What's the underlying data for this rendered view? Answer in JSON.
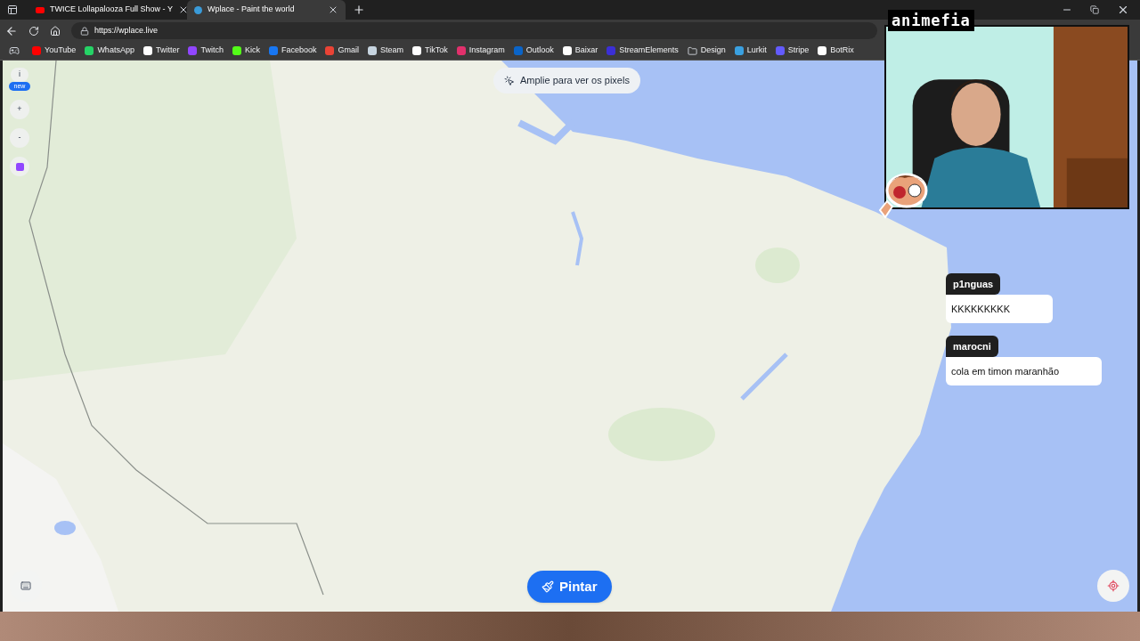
{
  "browser": {
    "tabs": [
      {
        "title": "TWICE Lollapalooza Full Show - Y",
        "selected": false
      },
      {
        "title": "Wplace - Paint the world",
        "selected": true
      }
    ],
    "url": "https://wplace.live",
    "bookmarks": [
      "YouTube",
      "WhatsApp",
      "Twitter",
      "Twitch",
      "Kick",
      "Facebook",
      "Gmail",
      "Steam",
      "TikTok",
      "Instagram",
      "Outlook",
      "Baixar",
      "StreamElements",
      "Design",
      "Lurkit",
      "Stripe",
      "BotRix"
    ]
  },
  "map": {
    "hint": "Amplie para ver os pixels",
    "info_button": "i",
    "new_badge": "new",
    "zoom_in": "+",
    "zoom_out": "-",
    "paint_button": "Pintar"
  },
  "stream": {
    "logo": "animefia",
    "chat": [
      {
        "user": "p1nguas",
        "message": "KKKKKKKKK"
      },
      {
        "user": "marocni",
        "message": "cola em timon maranhão"
      }
    ]
  }
}
